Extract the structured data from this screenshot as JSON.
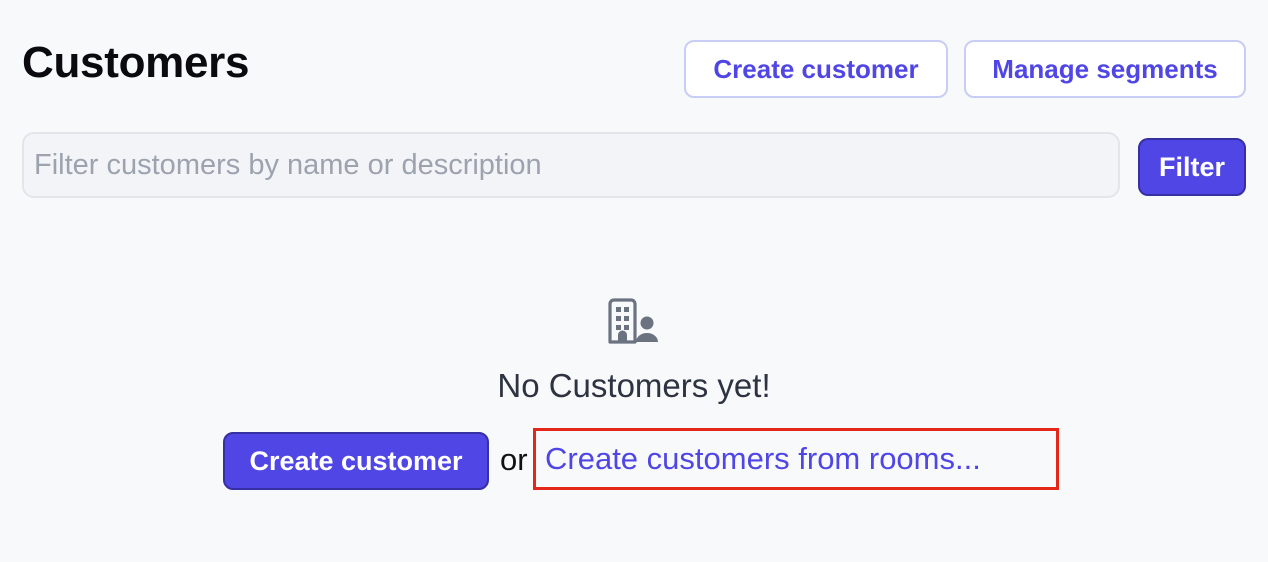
{
  "page": {
    "title": "Customers"
  },
  "header": {
    "create_customer_label": "Create customer",
    "manage_segments_label": "Manage segments"
  },
  "search": {
    "placeholder": "Filter customers by name or description",
    "value": "",
    "filter_label": "Filter"
  },
  "empty_state": {
    "icon": "building-person-icon",
    "message": "No Customers yet!",
    "create_customer_label": "Create customer",
    "or_text": "or",
    "create_from_rooms_label": "Create customers from rooms..."
  },
  "colors": {
    "accent": "#4f46e5",
    "highlight_box": "#e5261b",
    "background": "#f8f9fb"
  }
}
